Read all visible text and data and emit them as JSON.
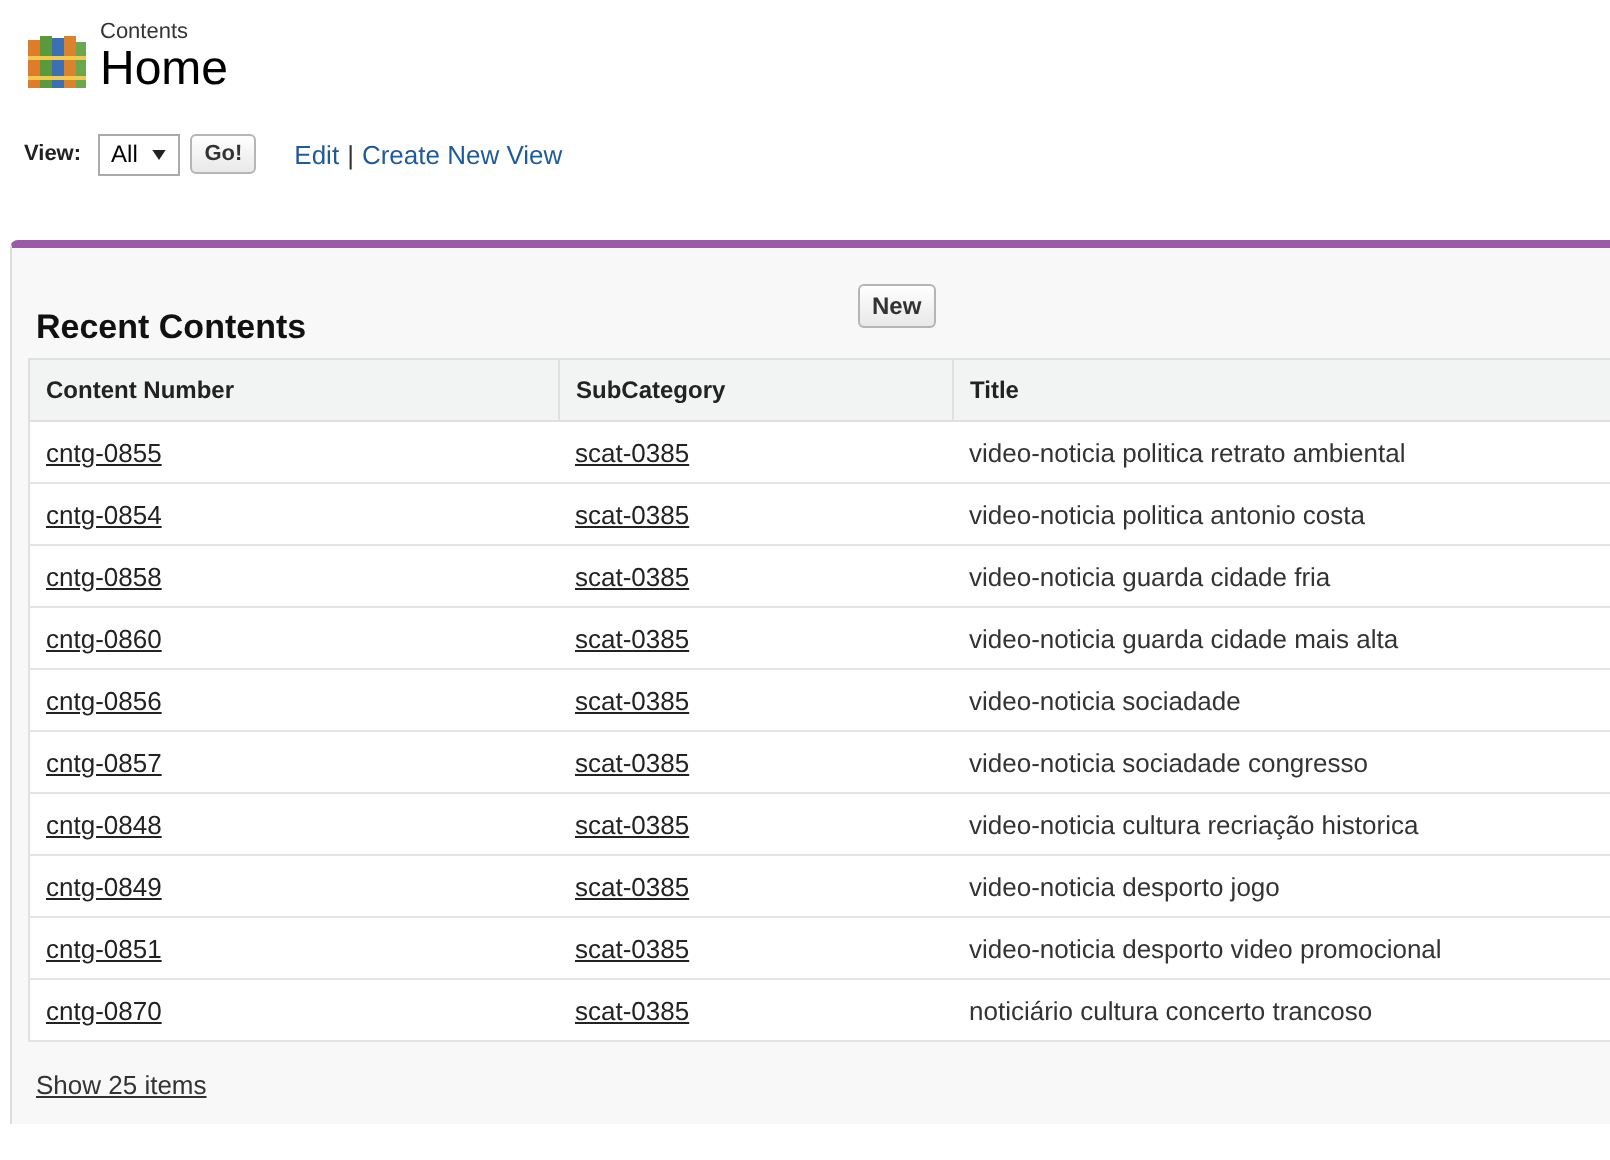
{
  "header": {
    "subtitle": "Contents",
    "title": "Home"
  },
  "view_bar": {
    "label": "View:",
    "select_value": "All",
    "go_button": "Go!",
    "links": [
      "Edit",
      "Create New View"
    ],
    "separator": "|"
  },
  "panel": {
    "title": "Recent Contents",
    "new_button": "New",
    "table": {
      "columns": [
        "Content Number",
        "SubCategory",
        "Title"
      ],
      "rows": [
        [
          "cntg-0855",
          "scat-0385",
          "video-noticia politica retrato ambiental"
        ],
        [
          "cntg-0854",
          "scat-0385",
          "video-noticia politica antonio costa"
        ],
        [
          "cntg-0858",
          "scat-0385",
          "video-noticia guarda cidade fria"
        ],
        [
          "cntg-0860",
          "scat-0385",
          "video-noticia guarda cidade mais alta"
        ],
        [
          "cntg-0856",
          "scat-0385",
          "video-noticia sociadade"
        ],
        [
          "cntg-0857",
          "scat-0385",
          "video-noticia sociadade congresso"
        ],
        [
          "cntg-0848",
          "scat-0385",
          "video-noticia cultura recriação historica"
        ],
        [
          "cntg-0849",
          "scat-0385",
          "video-noticia desporto jogo"
        ],
        [
          "cntg-0851",
          "scat-0385",
          "video-noticia desporto video promocional"
        ],
        [
          "cntg-0870",
          "scat-0385",
          "noticiário cultura concerto trancoso"
        ]
      ]
    },
    "footer_link": "Show 25 items"
  }
}
